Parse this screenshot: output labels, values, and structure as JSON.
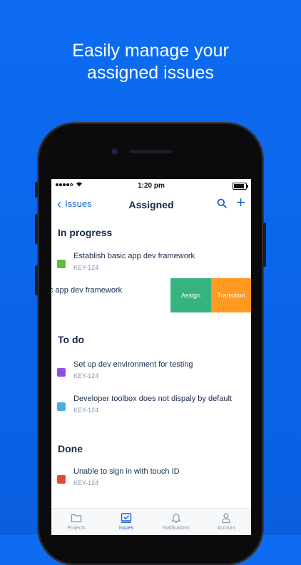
{
  "headline": {
    "line1": "Easily manage your",
    "line2": "assigned issues"
  },
  "status_bar": {
    "time": "1:20 pm"
  },
  "nav": {
    "back_label": "Issues",
    "title": "Assigned"
  },
  "sections": {
    "in_progress": "In progress",
    "to_do": "To do",
    "done": "Done"
  },
  "issues": [
    {
      "title": "Establish basic app dev framework",
      "key": "KEY-124",
      "icon": "story-icon",
      "color": "#63ba3c"
    },
    {
      "title": "Set up dev environment for testing",
      "key": "KEY-124",
      "icon": "epic-icon",
      "color": "#904ee2"
    },
    {
      "title": "Developer toolbox does not dispaly by default",
      "key": "KEY-124",
      "icon": "task-icon",
      "color": "#4bade8"
    },
    {
      "title": "Unable to sign in with touch ID",
      "key": "KEY-124",
      "icon": "bug-icon",
      "color": "#e5493a"
    }
  ],
  "swiped_row": {
    "title_fragment": "c app dev framework",
    "assign_label": "Assign",
    "transition_label": "Transition",
    "assign_color": "#36b37e",
    "transition_color": "#ff991f"
  },
  "tabs": [
    {
      "label": "Projects",
      "icon": "folder-icon",
      "active": false
    },
    {
      "label": "Issues",
      "icon": "issues-icon",
      "active": true
    },
    {
      "label": "Notifications",
      "icon": "bell-icon",
      "active": false
    },
    {
      "label": "Account",
      "icon": "person-icon",
      "active": false
    }
  ],
  "colors": {
    "brand_blue": "#0d6cf2",
    "accent": "#1a63d4",
    "text": "#172b4d"
  }
}
